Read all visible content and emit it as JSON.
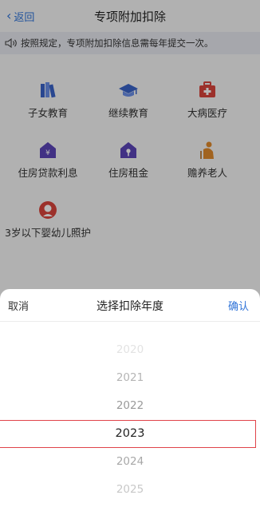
{
  "header": {
    "back_label": "返回",
    "title": "专项附加扣除"
  },
  "notice": {
    "text": "按照规定，专项附加扣除信息需每年提交一次。"
  },
  "items": [
    {
      "label": "子女教育"
    },
    {
      "label": "继续教育"
    },
    {
      "label": "大病医疗"
    },
    {
      "label": "住房贷款利息"
    },
    {
      "label": "住房租金"
    },
    {
      "label": "赡养老人"
    },
    {
      "label": "3岁以下婴幼儿照护"
    }
  ],
  "picker": {
    "cancel_label": "取消",
    "title": "选择扣除年度",
    "confirm_label": "确认",
    "years": [
      "2020",
      "2021",
      "2022",
      "2023",
      "2024",
      "2025"
    ],
    "selected": "2023"
  },
  "colors": {
    "accent": "#2f73d8",
    "selection_border": "#e0444a"
  },
  "icons": {
    "back": "chevron-left-icon",
    "notice": "speaker-icon",
    "items": [
      "books-icon",
      "graduation-cap-icon",
      "medical-kit-icon",
      "house-yen-icon",
      "house-key-icon",
      "elderly-person-icon",
      "baby-icon"
    ]
  }
}
